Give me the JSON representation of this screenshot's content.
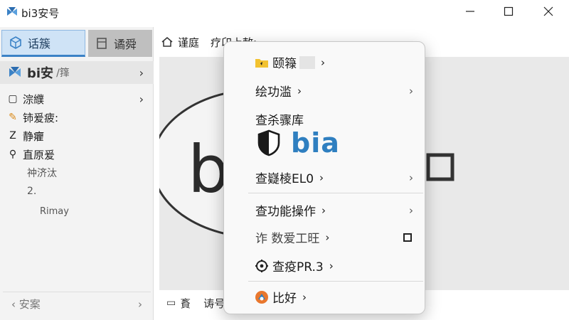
{
  "window": {
    "title": "bi3安号"
  },
  "sidebar": {
    "tabs": [
      {
        "label": "话簇"
      },
      {
        "label": "谲舜"
      }
    ],
    "brand": {
      "name": "bi安",
      "sub": "/箨"
    },
    "items": [
      {
        "label": "淙纀",
        "icon": "page-icon",
        "chevron": "›"
      },
      {
        "label": "铈爰疲:",
        "icon": "pencil-icon"
      },
      {
        "label": "静癯",
        "icon": "z-icon"
      },
      {
        "label": "直原爰",
        "icon": "pin-icon"
      },
      {
        "label": "祌济汰",
        "icon": ""
      },
      {
        "label": "2.",
        "icon": ""
      },
      {
        "label": "Rimay",
        "icon": ""
      }
    ],
    "footer": {
      "left": "‹  安案",
      "right": "›"
    }
  },
  "main": {
    "toolbar": {
      "label": "谨庭",
      "extra": "疗卬上敕:"
    },
    "footer": {
      "label1": "賌",
      "label2": "诪号"
    }
  },
  "canvas": {
    "logo_text": "bi"
  },
  "context_menu": {
    "items": [
      {
        "label": "颐簶",
        "suffix": "›",
        "icon": "folder-icon"
      },
      {
        "label": "绘功滥",
        "suffix": "›",
        "far": "›"
      },
      {
        "label": "查杀骤库",
        "suffix": ""
      },
      {
        "label": "查嶷棱EL0",
        "suffix": "›",
        "far": "›"
      },
      {
        "label": "查功能操作",
        "suffix": "›",
        "far": "›"
      },
      {
        "label": "诈 数爱⼯旺",
        "suffix": "›"
      },
      {
        "label": "查疫PR.3",
        "suffix": "›",
        "icon": "settings-icon"
      },
      {
        "label": "比好",
        "suffix": "›",
        "icon": "bia-circle-icon"
      }
    ],
    "brand_text": "bia",
    "brand_color": "#2f7fc0"
  },
  "colors": {
    "accent": "#3b82c6",
    "sidebar_bg": "#f3f3f3",
    "tab_active_bg": "#cfe3f6"
  }
}
